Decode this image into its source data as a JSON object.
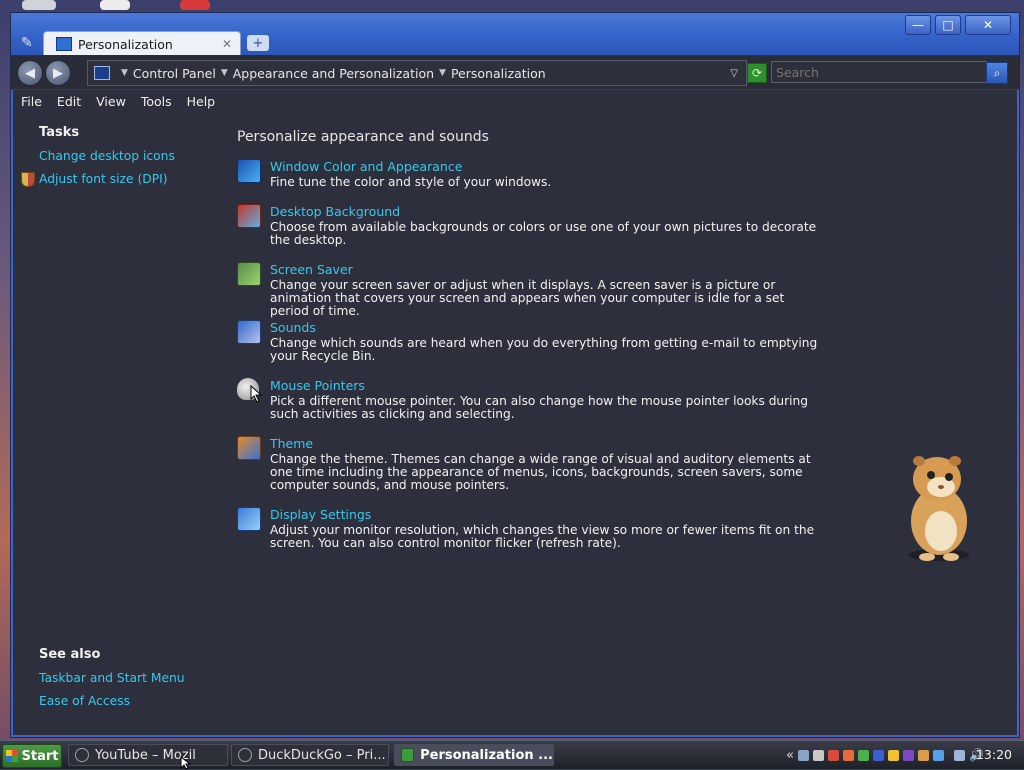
{
  "window": {
    "tab_title": "Personalization",
    "new_tab_symbol": "+",
    "controls": {
      "minimize": "—",
      "maximize": "□",
      "close": "✕"
    }
  },
  "address": {
    "path": [
      "Control Panel",
      "Appearance and Personalization",
      "Personalization"
    ],
    "search_placeholder": "Search"
  },
  "menu": [
    "File",
    "Edit",
    "View",
    "Tools",
    "Help"
  ],
  "sidebar": {
    "tasks_heading": "Tasks",
    "tasks": [
      "Change desktop icons",
      "Adjust font size (DPI)"
    ],
    "see_also_heading": "See also",
    "see_also": [
      "Taskbar and Start Menu",
      "Ease of Access"
    ]
  },
  "main": {
    "title": "Personalize appearance and sounds",
    "items": [
      {
        "title": "Window Color and Appearance",
        "desc": "Fine tune the color and style of your windows.",
        "icon": "window-color-icon"
      },
      {
        "title": "Desktop Background",
        "desc": "Choose from available backgrounds or colors or use one of your own pictures to decorate the desktop.",
        "icon": "desktop-background-icon"
      },
      {
        "title": "Screen Saver",
        "desc": "Change your screen saver or adjust when it displays. A screen saver is a picture or animation that covers your screen and appears when your computer is idle for a set period of time.",
        "icon": "screen-saver-icon"
      },
      {
        "title": "Sounds",
        "desc": "Change which sounds are heard when you do everything from getting e-mail to emptying your Recycle Bin.",
        "icon": "sounds-icon"
      },
      {
        "title": "Mouse Pointers",
        "desc": "Pick a different mouse pointer. You can also change how the mouse pointer looks during such activities as clicking and selecting.",
        "icon": "mouse-pointers-icon"
      },
      {
        "title": "Theme",
        "desc": "Change the theme. Themes can change a wide range of visual and auditory elements at one time including the appearance of menus, icons, backgrounds, screen savers, some computer sounds, and mouse pointers.",
        "icon": "theme-icon"
      },
      {
        "title": "Display Settings",
        "desc": "Adjust your monitor resolution, which changes the view so more or fewer items fit on the screen. You can also control monitor flicker (refresh rate).",
        "icon": "display-settings-icon"
      }
    ]
  },
  "taskbar": {
    "start_label": "Start",
    "tasks": [
      "YouTube – Mozil",
      "DuckDuckGo – Pri...",
      "Personalization ..."
    ],
    "expand_tray": "«",
    "clock": "13:20"
  },
  "colors": {
    "link": "#35c9ef",
    "window_bg": "#2d2f3d",
    "titlebar": "#3461c7"
  }
}
